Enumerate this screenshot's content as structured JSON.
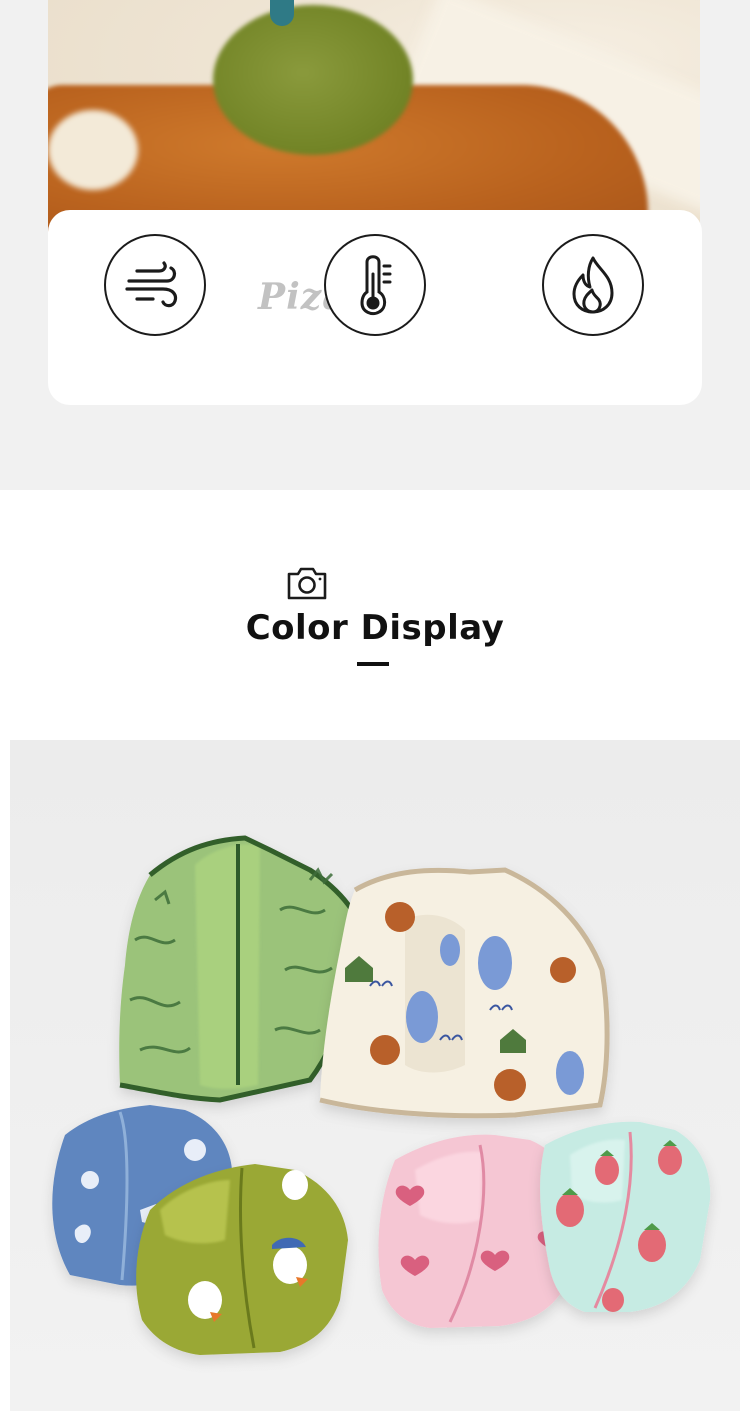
{
  "features": {
    "watermark": "Pizama",
    "icons": [
      "wind-icon",
      "thermometer-icon",
      "flame-icon"
    ]
  },
  "section": {
    "title": "Color Display",
    "icon": "camera-icon"
  },
  "colors": {
    "page_bg": "#f1f1f1",
    "card_bg": "#ffffff",
    "text": "#111111"
  }
}
